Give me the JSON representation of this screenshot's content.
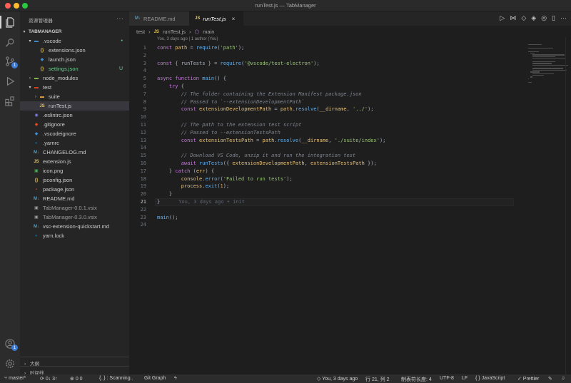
{
  "window": {
    "title": "runTest.js — TabManager"
  },
  "activity_bar": {
    "scm_badge": "1",
    "accounts_badge": "1"
  },
  "sidebar": {
    "header": "资源管理器",
    "more": "···",
    "root": "TABMANAGER",
    "items": [
      {
        "label": ".vscode",
        "icon": "folder-icon",
        "kind": "folder-open",
        "git": "•",
        "indent": 1
      },
      {
        "label": "extensions.json",
        "icon": "json-icon",
        "kind": "file",
        "git": "",
        "indent": 2
      },
      {
        "label": "launch.json",
        "icon": "launch-icon",
        "kind": "file",
        "git": "",
        "indent": 2
      },
      {
        "label": "settings.json",
        "icon": "json-icon",
        "kind": "file",
        "git": "U",
        "indent": 2
      },
      {
        "label": "node_modules",
        "icon": "folder-icon",
        "kind": "folder-closed",
        "git": "",
        "indent": 1
      },
      {
        "label": "test",
        "icon": "folder-icon",
        "kind": "folder-open",
        "git": "",
        "indent": 1
      },
      {
        "label": "suite",
        "icon": "folder-icon",
        "kind": "folder-closed",
        "git": "",
        "indent": 2
      },
      {
        "label": "runTest.js",
        "icon": "js-icon",
        "kind": "file",
        "git": "",
        "indent": 2,
        "selected": true
      },
      {
        "label": ".eslintrc.json",
        "icon": "eslint-icon",
        "kind": "file",
        "git": "",
        "indent": 1
      },
      {
        "label": ".gitignore",
        "icon": "git-icon",
        "kind": "file",
        "git": "",
        "indent": 1
      },
      {
        "label": ".vscodeignore",
        "icon": "vscode-icon",
        "kind": "file",
        "git": "",
        "indent": 1
      },
      {
        "label": ".yarnrc",
        "icon": "yarn-icon",
        "kind": "file",
        "git": "",
        "indent": 1
      },
      {
        "label": "CHANGELOG.md",
        "icon": "markdown-icon",
        "kind": "file",
        "git": "",
        "indent": 1
      },
      {
        "label": "extension.js",
        "icon": "js-icon",
        "kind": "file",
        "git": "",
        "indent": 1
      },
      {
        "label": "icon.png",
        "icon": "image-icon",
        "kind": "file",
        "git": "",
        "indent": 1
      },
      {
        "label": "jsconfig.json",
        "icon": "json-icon",
        "kind": "file",
        "git": "",
        "indent": 1
      },
      {
        "label": "package.json",
        "icon": "npm-icon",
        "kind": "file",
        "git": "",
        "indent": 1
      },
      {
        "label": "README.md",
        "icon": "markdown-icon",
        "kind": "file",
        "git": "",
        "indent": 1
      },
      {
        "label": "TabManager-0.0.1.vsix",
        "icon": "vsix-icon",
        "kind": "file",
        "git": "",
        "indent": 1,
        "dim": true
      },
      {
        "label": "TabManager-0.3.0.vsix",
        "icon": "vsix-icon",
        "kind": "file",
        "git": "",
        "indent": 1,
        "dim": true
      },
      {
        "label": "vsc-extension-quickstart.md",
        "icon": "markdown-icon",
        "kind": "file",
        "git": "",
        "indent": 1
      },
      {
        "label": "yarn.lock",
        "icon": "yarn-icon",
        "kind": "file",
        "git": "",
        "indent": 1
      }
    ],
    "outline": "大纲",
    "timeline": "时间线"
  },
  "tabs": [
    {
      "label": "README.md",
      "icon": "markdown-icon",
      "active": false
    },
    {
      "label": "runTest.js",
      "icon": "js-icon",
      "active": true
    }
  ],
  "breadcrumb": [
    "test",
    "runTest.js",
    "main"
  ],
  "codelens": "You, 3 days ago | 1 author (You)",
  "code_lines": [
    "const path = require('path');",
    "",
    "const { runTests } = require('@vscode/test-electron');",
    "",
    "async function main() {",
    "    try {",
    "        // The folder containing the Extension Manifest package.json",
    "        // Passed to `--extensionDevelopmentPath`",
    "        const extensionDevelopmentPath = path.resolve(__dirname, '../');",
    "",
    "        // The path to the extension test script",
    "        // Passed to --extensionTestsPath",
    "        const extensionTestsPath = path.resolve(__dirname, './suite/index');",
    "",
    "        // Download VS Code, unzip it and run the integration test",
    "        await runTests({ extensionDevelopmentPath, extensionTestsPath });",
    "    } catch (err) {",
    "        console.error('Failed to run tests');",
    "        process.exit(1);",
    "    }",
    "}",
    "",
    "main();",
    ""
  ],
  "current_line": 21,
  "inline_blame": "You, 3 days ago • init",
  "statusbar": {
    "branch": "master*",
    "sync": "0↓ 3↑",
    "problems": "0 0",
    "scanning": "{..} : Scanning..",
    "git_graph": "Git Graph",
    "blame": "You, 3 days ago",
    "position": "行 21, 列 2",
    "tab_size": "制表符长度: 4",
    "encoding": "UTF-8",
    "eol": "LF",
    "language": "JavaScript",
    "prettier": "✓ Prettier"
  },
  "colors": {
    "accent": "#3a7bd5",
    "js": "#e8c547",
    "json": "#e8c547",
    "git_untracked": "#73c991",
    "git_modified": "#73c991"
  }
}
